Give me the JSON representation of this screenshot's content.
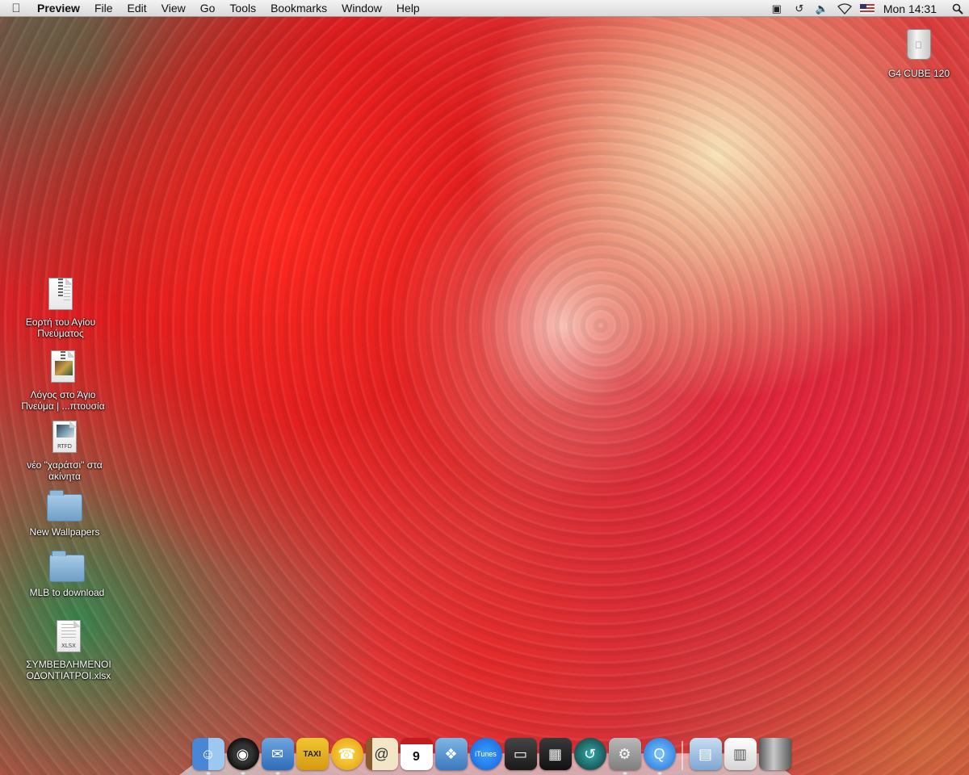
{
  "menubar": {
    "apple_icon": "apple-logo",
    "app_name": "Preview",
    "items": [
      "File",
      "Edit",
      "View",
      "Go",
      "Tools",
      "Bookmarks",
      "Window",
      "Help"
    ],
    "status_icons": [
      "display-icon",
      "time-machine-icon",
      "volume-icon",
      "wifi-icon",
      "us-flag-input-icon"
    ],
    "clock": "Mon 14:31",
    "spotlight_icon": "magnifier-icon"
  },
  "desktop": {
    "drive": {
      "label": "G4 CUBE 120",
      "icon": "drive-icon"
    },
    "files": [
      {
        "label_line1": "Εορτή του Αγίου",
        "label_line2": "Πνεύματος",
        "icon": "zip-document-icon"
      },
      {
        "label_line1": "Λόγος στο Άγιο",
        "label_line2": "Πνεύμα | ...πτουσία",
        "icon": "document-with-picture-icon"
      },
      {
        "label_line1": "νέο \"χαράτσι\" στα",
        "label_line2": "ακίνητα",
        "icon": "rtfd-document-icon",
        "tag": "RTFD"
      },
      {
        "label_line1": "New Wallpapers",
        "label_line2": "",
        "icon": "folder-icon"
      },
      {
        "label_line1": "MLB to download",
        "label_line2": "",
        "icon": "folder-icon"
      },
      {
        "label_line1": "ΣΥΜΒΕΒΛΗΜΕΝΟΙ",
        "label_line2": "ΟΔΟΝΤΙΑΤΡΟΙ.xlsx",
        "icon": "xlsx-document-icon",
        "tag": "XLSX"
      }
    ]
  },
  "dock": {
    "apps": [
      {
        "name": "Finder",
        "glyph": "☺"
      },
      {
        "name": "Dashboard",
        "glyph": "◉"
      },
      {
        "name": "Mail",
        "glyph": "✉"
      },
      {
        "name": "Taxi",
        "glyph": "TAXI"
      },
      {
        "name": "Chat",
        "glyph": "☎"
      },
      {
        "name": "Address Book",
        "glyph": "@"
      },
      {
        "name": "iCal",
        "glyph": "9"
      },
      {
        "name": "iPhoto",
        "glyph": "❖"
      },
      {
        "name": "iTunes",
        "glyph": "iTunes"
      },
      {
        "name": "Front Row",
        "glyph": "▭"
      },
      {
        "name": "Spaces",
        "glyph": "▦"
      },
      {
        "name": "Time Machine",
        "glyph": "↺"
      },
      {
        "name": "System Preferences",
        "glyph": "⚙"
      },
      {
        "name": "QuickTime",
        "glyph": "Q"
      }
    ],
    "stacks": [
      {
        "name": "Documents",
        "glyph": "▤"
      },
      {
        "name": "Downloads",
        "glyph": "▥"
      },
      {
        "name": "Trash",
        "glyph": ""
      }
    ]
  }
}
